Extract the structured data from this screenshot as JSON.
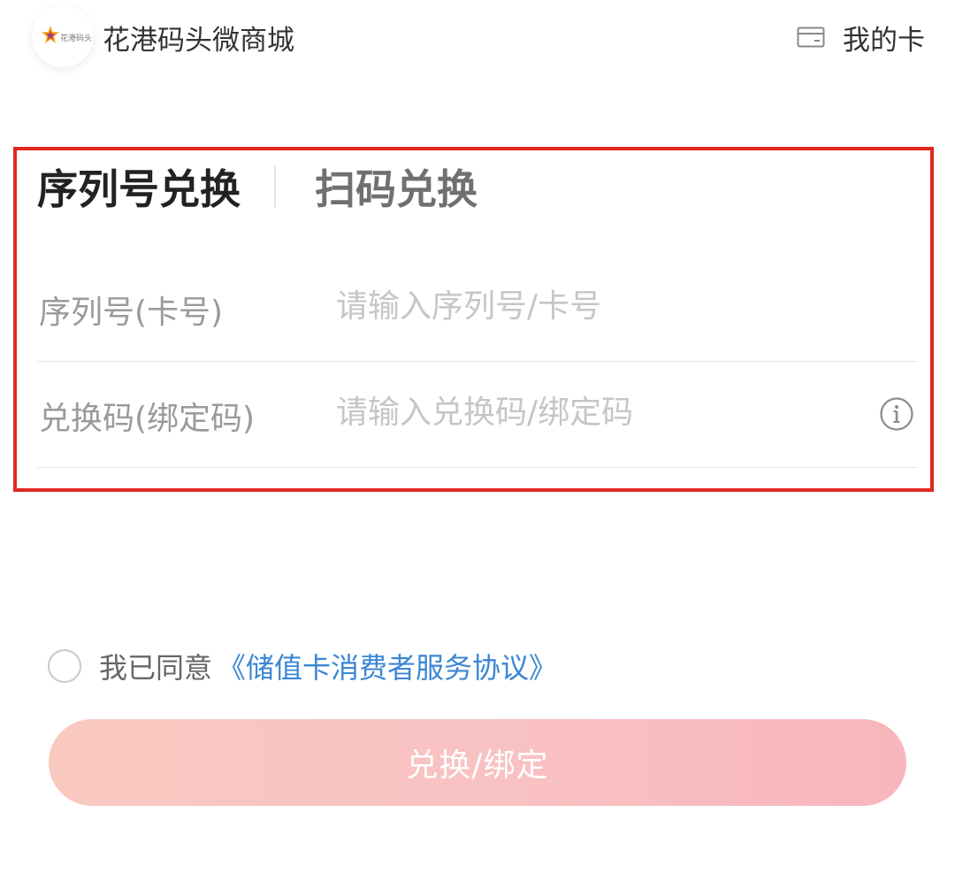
{
  "header": {
    "logo_text": "花港码头",
    "shop_name": "花港码头微商城",
    "my_card_label": "我的卡",
    "card_icon": "card-icon"
  },
  "tabs": [
    {
      "label": "序列号兑换",
      "active": true
    },
    {
      "label": "扫码兑换",
      "active": false
    }
  ],
  "form": {
    "serial": {
      "label": "序列号(卡号)",
      "placeholder": "请输入序列号/卡号",
      "value": ""
    },
    "code": {
      "label": "兑换码(绑定码)",
      "placeholder": "请输入兑换码/绑定码",
      "value": "",
      "help_icon": "info-icon"
    }
  },
  "agreement": {
    "checked": false,
    "text": "我已同意",
    "link": "《储值卡消费者服务协议》"
  },
  "submit": {
    "label": "兑换/绑定"
  },
  "colors": {
    "highlight_border": "#e0281e",
    "link": "#3b86d4",
    "button_start": "#f9c9c0",
    "button_end": "#f7b6bc"
  }
}
